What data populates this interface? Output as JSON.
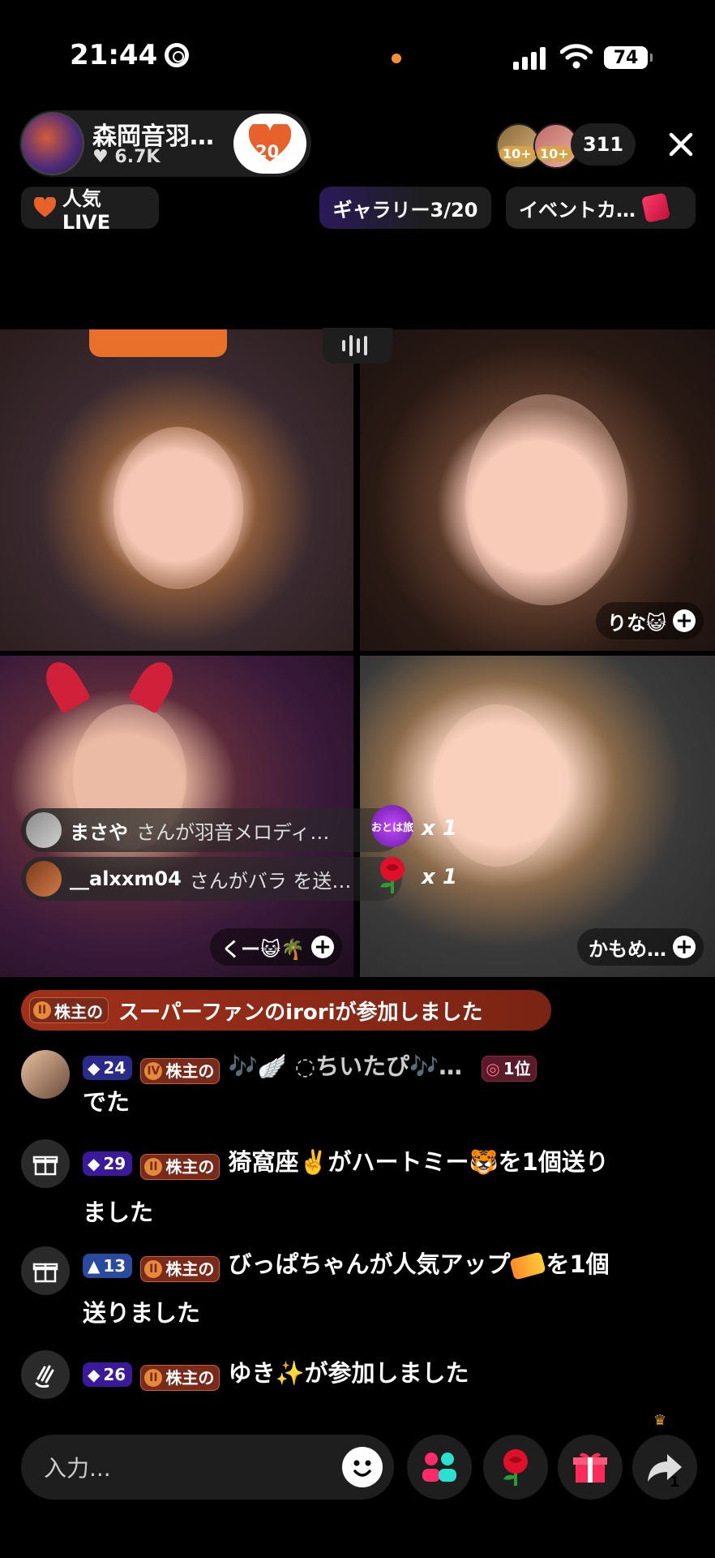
{
  "status_bar": {
    "time": "21:44",
    "battery": "74"
  },
  "host": {
    "name": "森岡音羽…",
    "likes": "6.7K",
    "follow_badge_count": "20"
  },
  "viewers": {
    "badge1": "10+",
    "badge2": "10+",
    "count": "311"
  },
  "chips": {
    "live": "人気LIVE",
    "gallery": "ギャラリー3/20",
    "event": "イベントカ…"
  },
  "tiles": {
    "t2_label": "りな😺",
    "t3_label": "くー😺🌴",
    "t4_label": "かもめ…"
  },
  "gift_banners": [
    {
      "name": "まさや",
      "text": "さんが羽音メロディ…",
      "icon_label": "おとは旅",
      "count": "x 1"
    },
    {
      "name": "__alxxm04",
      "text": "さんがバラ を送…",
      "icon_label": "rose",
      "count": "x 1"
    }
  ],
  "join_banner": {
    "badge": "株主の",
    "text": "スーパーファンのiroriが参加しました"
  },
  "chat": [
    {
      "level": "24",
      "badge": "株主の",
      "name": "🎶🪽 ◌ちいたぴ🎶…",
      "rank": "1位",
      "text": "でた"
    },
    {
      "level": "29",
      "badge": "株主の",
      "text": "猗窩座✌️がハートミー🐯を1個送り",
      "text2": "ました"
    },
    {
      "level": "13",
      "badge": "株主の",
      "text": "びっぱちゃんが人気アップ",
      "text_tail": "を1個",
      "text2": "送りました"
    },
    {
      "level": "26",
      "badge": "株主の",
      "text": "ゆき✨が参加しました"
    }
  ],
  "input": {
    "placeholder": "入力..."
  },
  "share_count": "1",
  "colors": {
    "accent_orange": "#e86a2a",
    "shareholder_red": "#a0301a",
    "level_blue": "#2a2a8a"
  }
}
